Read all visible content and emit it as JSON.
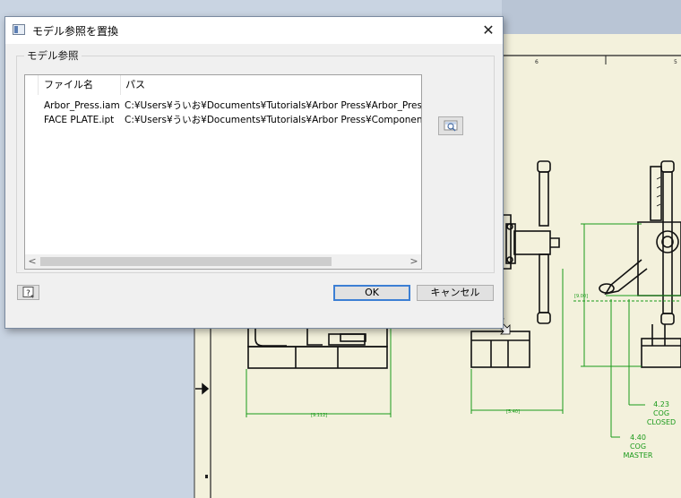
{
  "dialog": {
    "title": "モデル参照を置換",
    "close_glyph": "✕",
    "group_label": "モデル参照",
    "columns": [
      "ファイル名",
      "パス"
    ],
    "rows": [
      {
        "file": "Arbor_Press.iam",
        "path": "C:¥Users¥ういお¥Documents¥Tutorials¥Arbor Press¥Arbor_Press"
      },
      {
        "file": "FACE PLATE.ipt",
        "path": "C:¥Users¥ういお¥Documents¥Tutorials¥Arbor Press¥Components"
      }
    ],
    "scroll_left": "<",
    "scroll_right": ">",
    "browse_icon": "browse-folder-icon",
    "help_icon": "help-icon",
    "ok_label": "OK",
    "cancel_label": "キャンセル"
  },
  "drawing": {
    "ruler_marks": [
      "6",
      "5"
    ],
    "dim_1": "[9.00]",
    "dim_2": "[9.112]",
    "dim_3": "[5.40]",
    "cog_closed": [
      "4.23",
      "COG",
      "CLOSED"
    ],
    "cog_master": [
      "4.40",
      "COG",
      "MASTER"
    ],
    "sheet_color": "#f3f1dc",
    "dim_color": "#1a9a1a"
  }
}
